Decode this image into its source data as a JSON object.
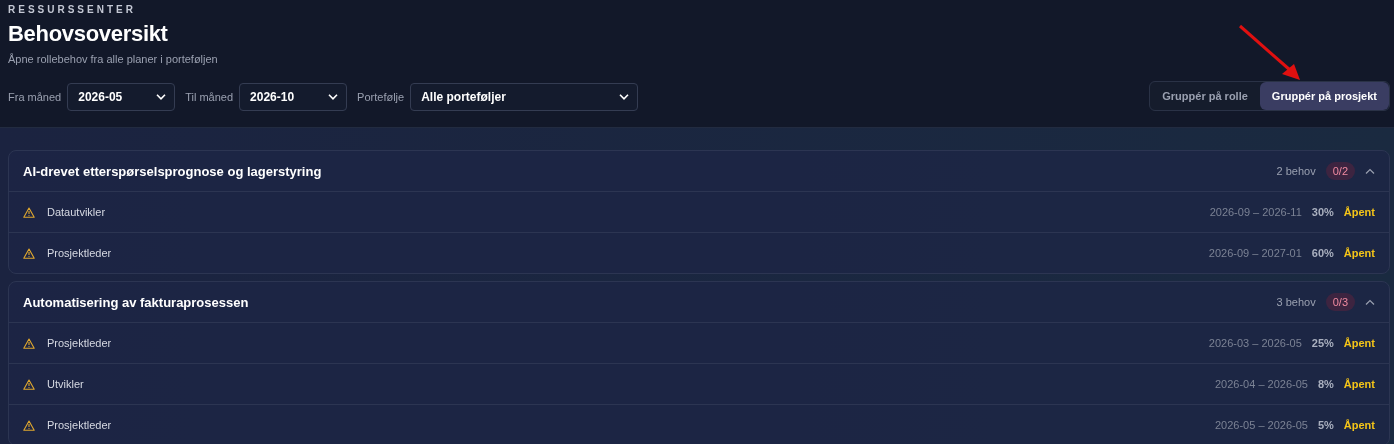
{
  "header": {
    "eyebrow": "RESSURSSENTER",
    "title": "Behovsoversikt",
    "subtitle": "Åpne rollebehov fra alle planer i porteføljen"
  },
  "filters": [
    {
      "label": "Fra måned",
      "value": "2026-05"
    },
    {
      "label": "Til måned",
      "value": "2026-10"
    },
    {
      "label": "Portefølje",
      "value": "Alle porteføljer"
    }
  ],
  "grouping": [
    {
      "label": "Gruppér på rolle",
      "selected": false
    },
    {
      "label": "Gruppér på prosjekt",
      "selected": true
    }
  ],
  "groups": [
    {
      "title": "AI-drevet etterspørselsprognose og lagerstyring",
      "count": "2 behov",
      "filled": "0/2",
      "expanded": true,
      "needs": [
        {
          "role": "Datautvikler",
          "period": "2026-09 – 2026-11",
          "share": "30%",
          "status": "Åpent"
        },
        {
          "role": "Prosjektleder",
          "period": "2026-09 – 2027-01",
          "share": "60%",
          "status": "Åpent"
        }
      ]
    },
    {
      "title": "Automatisering av fakturaprosessen",
      "count": "3 behov",
      "filled": "0/3",
      "expanded": true,
      "needs": [
        {
          "role": "Prosjektleder",
          "period": "2026-03 – 2026-05",
          "share": "25%",
          "status": "Åpent"
        },
        {
          "role": "Utvikler",
          "period": "2026-04 – 2026-05",
          "share": "8%",
          "status": "Åpent"
        },
        {
          "role": "Prosjektleder",
          "period": "2026-05 – 2026-05",
          "share": "5%",
          "status": "Åpent"
        }
      ]
    }
  ]
}
